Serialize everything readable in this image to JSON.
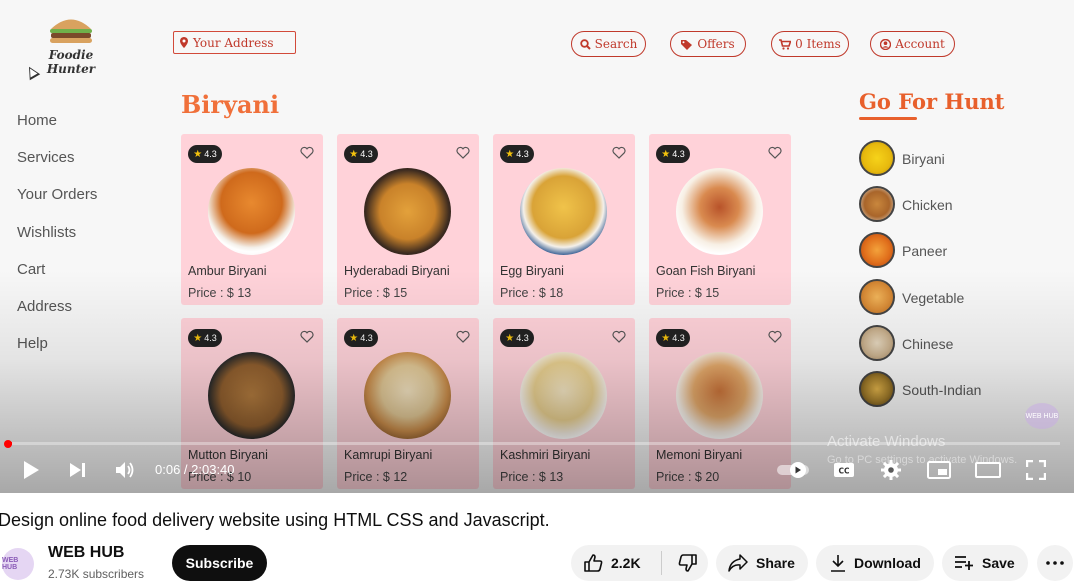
{
  "site": {
    "logo_text": "Foodie Hunter",
    "address_placeholder": "Your Address",
    "nav": {
      "search": "Search",
      "offers": "Offers",
      "cart": "0 Items",
      "account": "Account"
    },
    "sidebar": [
      "Home",
      "Services",
      "Your Orders",
      "Wishlists",
      "Cart",
      "Address",
      "Help"
    ],
    "section_title": "Biryani",
    "cards": [
      {
        "rating": "4.3",
        "name": "Ambur Biryani",
        "price": "Price : $ 13"
      },
      {
        "rating": "4.3",
        "name": "Hyderabadi Biryani",
        "price": "Price : $ 15"
      },
      {
        "rating": "4.3",
        "name": "Egg Biryani",
        "price": "Price : $ 18"
      },
      {
        "rating": "4.3",
        "name": "Goan Fish Biryani",
        "price": "Price : $ 15"
      },
      {
        "rating": "4.3",
        "name": "Mutton Biryani",
        "price": "Price : $ 10"
      },
      {
        "rating": "4.3",
        "name": "Kamrupi Biryani",
        "price": "Price : $ 12"
      },
      {
        "rating": "4.3",
        "name": "Kashmiri Biryani",
        "price": "Price : $ 13"
      },
      {
        "rating": "4.3",
        "name": "Memoni Biryani",
        "price": "Price : $ 20"
      }
    ],
    "hunt_title": "Go For Hunt",
    "hunt_items": [
      "Biryani",
      "Chicken",
      "Paneer",
      "Vegetable",
      "Chinese",
      "South-Indian"
    ],
    "watermark_title": "Activate Windows",
    "watermark_sub": "Go to PC settings to activate Windows."
  },
  "player": {
    "time": "0:06 / 2:03:40",
    "progress_fraction": 0.0008,
    "channel_watermark": "WEB HUB"
  },
  "video": {
    "title": "Design online food delivery website using HTML CSS and Javascript.",
    "channel_name": "WEB HUB",
    "subscribers": "2.73K subscribers",
    "subscribe_label": "Subscribe",
    "likes": "2.2K",
    "share_label": "Share",
    "download_label": "Download",
    "save_label": "Save",
    "avatar_text": "WEB HUB"
  },
  "colors": {
    "accent": "#f0703a",
    "card_bg": "#ffd2d9",
    "nav_red": "#c0392b",
    "progress": "#ff0000"
  }
}
